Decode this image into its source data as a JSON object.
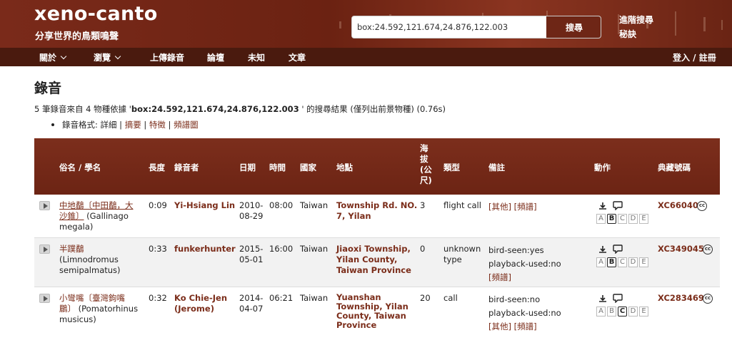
{
  "header": {
    "logo": "xeno-canto",
    "tagline": "分享世界的鳥類鳴聲",
    "search_value": "box:24.592,121.674,24.876,122.003",
    "search_button": "搜尋",
    "advanced_search": "進階搜尋",
    "tips": "秘訣"
  },
  "nav": {
    "about": "關於",
    "browse": "瀏覽",
    "upload": "上傳錄音",
    "forum": "論壇",
    "mystery": "未知",
    "articles": "文章",
    "login": "登入 / 註冊"
  },
  "page": {
    "title": "錄音",
    "summary_pre": "5 筆錄音來自 4 物種依據 '",
    "summary_query": "box:24.592,121.674,24.876,122.003",
    "summary_post": " ' 的搜尋結果 (僅列出前景物種) (0.76s)",
    "formats_label": "錄音格式: ",
    "format_detailed": "詳細",
    "format_concise": "摘要",
    "format_codes": "特徵",
    "format_sonograms": "頻譜圖"
  },
  "table": {
    "headers": {
      "name": "俗名 / 學名",
      "length": "長度",
      "recordist": "錄音者",
      "date": "日期",
      "time": "時間",
      "country": "國家",
      "location": "地點",
      "elevation": [
        "海",
        "拔",
        "(公",
        "尺)"
      ],
      "type": "類型",
      "remarks": "備註",
      "actions": "動作",
      "catalog": "典藏號碼"
    },
    "rows": [
      {
        "common_1": "中地鷸〔中田鷸，大",
        "common_2": "沙錐〕",
        "sci_1": " (Gallinago",
        "sci_2": "megala)",
        "length": "0:09",
        "recordist": "Yi-Hsiang Lin",
        "date_1": "2010-",
        "date_2": "08-29",
        "time": "08:00",
        "country": "Taiwan",
        "loc_1": "Township Rd. NO.",
        "loc_2": "7, Yilan",
        "elev": "3",
        "type": "flight call",
        "remark_1": "[其他] [頻譜]",
        "grade": "B",
        "catalog": "XC66040"
      },
      {
        "common_1": "半蹼鷸",
        "sci_1": "(Limnodromus",
        "sci_2": "semipalmatus)",
        "length": "0:33",
        "recordist": "funkerhunter",
        "date_1": "2015-",
        "date_2": "05-01",
        "time": "16:00",
        "country": "Taiwan",
        "loc_1": "Jiaoxi Township,",
        "loc_2": "Yilan County,",
        "loc_3": "Taiwan Province",
        "elev": "0",
        "type_1": "unknown",
        "type_2": "type",
        "remark_1": "bird-seen:yes",
        "remark_2": "playback-used:no",
        "remark_3": "[頻譜]",
        "grade": "B",
        "catalog": "XC349045"
      },
      {
        "common_1": "小彎嘴〔臺灣鉤嘴",
        "common_2": "鶥〕",
        "sci_1": " (Pomatorhinus",
        "sci_2": "musicus)",
        "length": "0:32",
        "recordist_1": "Ko Chie-Jen",
        "recordist_2": "(Jerome)",
        "date_1": "2014-",
        "date_2": "04-07",
        "time": "06:21",
        "country": "Taiwan",
        "loc_1": "Yuanshan",
        "loc_2": "Township, Yilan",
        "loc_3": "County, Taiwan",
        "loc_4": "Province",
        "elev": "20",
        "type": "call",
        "remark_1": "bird-seen:no",
        "remark_2": "playback-used:no",
        "remark_3": "[其他] [頻譜]",
        "grade": "C",
        "catalog": "XC283469"
      }
    ],
    "grades": [
      "A",
      "B",
      "C",
      "D",
      "E"
    ],
    "cc_label": "cc"
  }
}
